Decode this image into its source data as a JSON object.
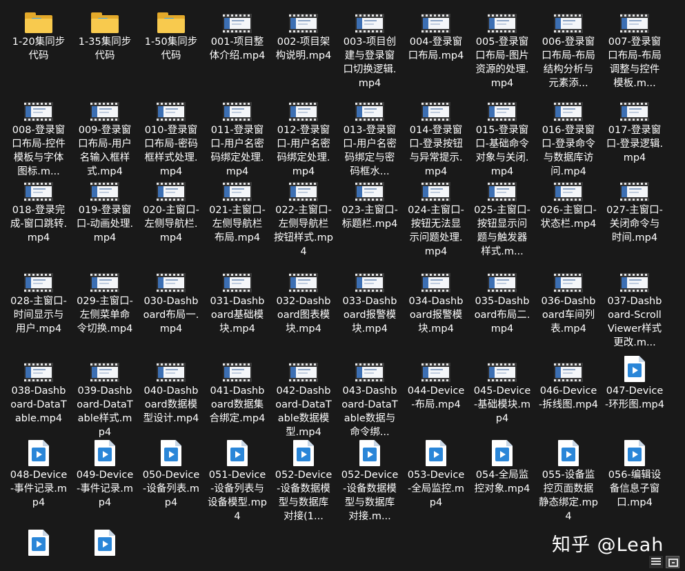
{
  "files": [
    {
      "name": "1-20集同步代码",
      "type": "folder"
    },
    {
      "name": "1-35集同步代码",
      "type": "folder"
    },
    {
      "name": "1-50集同步代码",
      "type": "folder"
    },
    {
      "name": "001-项目整体介绍.mp4",
      "type": "video-thumb"
    },
    {
      "name": "002-项目架构说明.mp4",
      "type": "video-thumb"
    },
    {
      "name": "003-项目创建与登录窗口切换逻辑.mp4",
      "type": "video-thumb"
    },
    {
      "name": "004-登录窗口布局.mp4",
      "type": "video-thumb"
    },
    {
      "name": "005-登录窗口布局-图片资源的处理.mp4",
      "type": "video-thumb"
    },
    {
      "name": "006-登录窗口布局-布局结构分析与元素添...",
      "type": "video-thumb"
    },
    {
      "name": "007-登录窗口布局-布局调整与控件模板.m...",
      "type": "video-thumb"
    },
    {
      "name": "008-登录窗口布局-控件模板与字体图标.m...",
      "type": "video-thumb"
    },
    {
      "name": "009-登录窗口布局-用户名输入框样式.mp4",
      "type": "video-thumb"
    },
    {
      "name": "010-登录窗口布局-密码框样式处理.mp4",
      "type": "video-thumb"
    },
    {
      "name": "011-登录窗口-用户名密码绑定处理.mp4",
      "type": "video-thumb"
    },
    {
      "name": "012-登录窗口-用户名密码绑定处理.mp4",
      "type": "video-thumb"
    },
    {
      "name": "013-登录窗口-用户名密码绑定与密码框水...",
      "type": "video-thumb"
    },
    {
      "name": "014-登录窗口-登录按钮与异常提示.mp4",
      "type": "video-thumb"
    },
    {
      "name": "015-登录窗口-基础命令对象与关闭.mp4",
      "type": "video-thumb"
    },
    {
      "name": "016-登录窗口-登录命令与数据库访问.mp4",
      "type": "video-thumb"
    },
    {
      "name": "017-登录窗口-登录逻辑.mp4",
      "type": "video-thumb"
    },
    {
      "name": "018-登录完成-窗口跳转.mp4",
      "type": "video-thumb"
    },
    {
      "name": "019-登录窗口-动画处理.mp4",
      "type": "video-thumb"
    },
    {
      "name": "020-主窗口-左侧导航栏.mp4",
      "type": "video-thumb"
    },
    {
      "name": "021-主窗口-左侧导航栏布局.mp4",
      "type": "video-thumb"
    },
    {
      "name": "022-主窗口-左侧导航栏按钮样式.mp4",
      "type": "video-thumb"
    },
    {
      "name": "023-主窗口-标题栏.mp4",
      "type": "video-thumb"
    },
    {
      "name": "024-主窗口-按钮无法显示问题处理.mp4",
      "type": "video-thumb"
    },
    {
      "name": "025-主窗口-按钮显示问题与触发器样式.m...",
      "type": "video-thumb"
    },
    {
      "name": "026-主窗口-状态栏.mp4",
      "type": "video-thumb"
    },
    {
      "name": "027-主窗口-关闭命令与时间.mp4",
      "type": "video-thumb"
    },
    {
      "name": "028-主窗口-时间显示与用户.mp4",
      "type": "video-thumb"
    },
    {
      "name": "029-主窗口-左侧菜单命令切换.mp4",
      "type": "video-thumb"
    },
    {
      "name": "030-Dashboard布局一.mp4",
      "type": "video-thumb"
    },
    {
      "name": "031-Dashboard基础模块.mp4",
      "type": "video-thumb"
    },
    {
      "name": "032-Dashboard图表模块.mp4",
      "type": "video-thumb"
    },
    {
      "name": "033-Dashboard报警模块.mp4",
      "type": "video-thumb"
    },
    {
      "name": "034-Dashboard报警模块.mp4",
      "type": "video-thumb"
    },
    {
      "name": "035-Dashboard布局二.mp4",
      "type": "video-thumb"
    },
    {
      "name": "036-Dashboard车间列表.mp4",
      "type": "video-thumb"
    },
    {
      "name": "037-Dashboard-ScrollViewer样式更改.m...",
      "type": "video-thumb"
    },
    {
      "name": "038-Dashboard-DataTable.mp4",
      "type": "video-thumb"
    },
    {
      "name": "039-Dashboard-DataTable样式.mp4",
      "type": "video-thumb"
    },
    {
      "name": "040-Dashboard数据模型设计.mp4",
      "type": "video-thumb"
    },
    {
      "name": "041-Dashboard数据集合绑定.mp4",
      "type": "video-thumb"
    },
    {
      "name": "042-Dashboard-DataTable数据模型.mp4",
      "type": "video-thumb"
    },
    {
      "name": "043-Dashboard-DataTable数据与命令绑...",
      "type": "video-thumb"
    },
    {
      "name": "044-Device-布局.mp4",
      "type": "video-thumb"
    },
    {
      "name": "045-Device-基础模块.mp4",
      "type": "video-thumb"
    },
    {
      "name": "046-Device-拆线图.mp4",
      "type": "video-thumb"
    },
    {
      "name": "047-Device-环形图.mp4",
      "type": "media-file"
    },
    {
      "name": "048-Device-事件记录.mp4",
      "type": "media-file"
    },
    {
      "name": "049-Device-事件记录.mp4",
      "type": "media-file"
    },
    {
      "name": "050-Device-设备列表.mp4",
      "type": "media-file"
    },
    {
      "name": "051-Device-设备列表与设备模型.mp4",
      "type": "media-file"
    },
    {
      "name": "052-Device-设备数据模型与数据库对接(1...",
      "type": "media-file"
    },
    {
      "name": "052-Device-设备数据模型与数据库对接.m...",
      "type": "media-file"
    },
    {
      "name": "053-Device-全局监控.mp4",
      "type": "media-file"
    },
    {
      "name": "054-全局监控对象.mp4",
      "type": "media-file"
    },
    {
      "name": "055-设备监控页面数据静态绑定.mp4",
      "type": "media-file"
    },
    {
      "name": "056-编辑设备信息子窗口.mp4",
      "type": "media-file"
    },
    {
      "name": "",
      "type": "media-file"
    },
    {
      "name": "",
      "type": "media-file"
    }
  ],
  "watermark": "知乎 @Leah",
  "view_buttons": {
    "details": "details-view-icon",
    "tiles": "large-icons-view-icon"
  }
}
